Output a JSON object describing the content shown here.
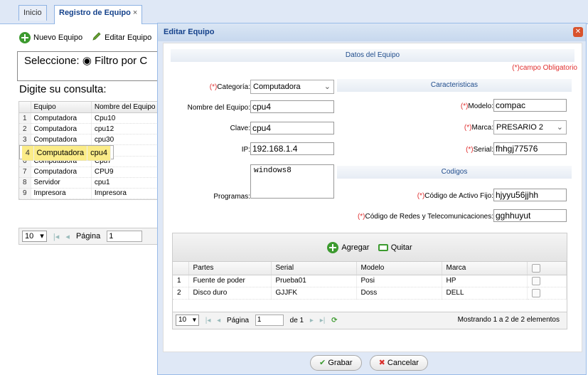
{
  "tabs": [
    {
      "label": "Inicio"
    },
    {
      "label": "Registro de Equipo",
      "close": "×"
    }
  ],
  "toolbar": {
    "nuevo": "Nuevo Equipo",
    "editar": "Editar Equipo"
  },
  "filter": {
    "legend": "Seleccione:",
    "radio_label": "Filtro por C"
  },
  "consulta_label": "Digite su consulta:",
  "grid": {
    "headers": [
      "Equipo",
      "Nombre del Equipo"
    ],
    "rows": [
      {
        "n": "1",
        "equipo": "Computadora",
        "nombre": "Cpu10"
      },
      {
        "n": "2",
        "equipo": "Computadora",
        "nombre": "cpu12"
      },
      {
        "n": "3",
        "equipo": "Computadora",
        "nombre": "cpu30"
      },
      {
        "n": "4",
        "equipo": "Computadora",
        "nombre": "cpu4"
      },
      {
        "n": "5",
        "equipo": "Computadora",
        "nombre": "cpu5"
      },
      {
        "n": "6",
        "equipo": "Computadora",
        "nombre": "Cpu7"
      },
      {
        "n": "7",
        "equipo": "Computadora",
        "nombre": "CPU9"
      },
      {
        "n": "8",
        "equipo": "Servidor",
        "nombre": "cpu1"
      },
      {
        "n": "9",
        "equipo": "Impresora",
        "nombre": "Impresora"
      }
    ],
    "pager": {
      "size": "10",
      "page_label": "Página",
      "page": "1"
    }
  },
  "modal": {
    "title": "Editar Equipo",
    "section_main": "Datos del Equipo",
    "obligatorio": "(*)campo Obligatorio",
    "caracteristicas": "Caracteristicas",
    "codigos": "Codigos",
    "fields": {
      "categoria_label": "Categoría:",
      "categoria": "Computadora",
      "nombre_label": "Nombre del Equipo:",
      "nombre": "cpu4",
      "clave_label": "Clave:",
      "clave": "cpu4",
      "ip_label": "IP:",
      "ip": "192.168.1.4",
      "programas_label": "Programas:",
      "programas": "windows8",
      "modelo_label": "Modelo:",
      "modelo": "compac",
      "marca_label": "Marca:",
      "marca": "PRESARIO 2",
      "serial_label": "Serial:",
      "serial": "fhhgj77576",
      "activo_label": "Código de Activo Fijo:",
      "activo": "hjyyu56jjhh",
      "redes_label": "Código de Redes y Telecomunicaciones:",
      "redes": "gghhuyut"
    },
    "req_mark": "(*)",
    "parts": {
      "agregar": "Agregar",
      "quitar": "Quitar",
      "headers": [
        "Partes",
        "Serial",
        "Modelo",
        "Marca"
      ],
      "rows": [
        {
          "n": "1",
          "partes": "Fuente de poder",
          "serial": "Prueba01",
          "modelo": "Posi",
          "marca": "HP"
        },
        {
          "n": "2",
          "partes": "Disco duro",
          "serial": "GJJFK",
          "modelo": "Doss",
          "marca": "DELL"
        }
      ],
      "pager": {
        "size": "10",
        "page_label": "Página",
        "page": "1",
        "of": "de 1",
        "status": "Mostrando 1 a 2 de 2 elementos"
      }
    },
    "grabar": "Grabar",
    "cancelar": "Cancelar"
  },
  "colors": {
    "accent": "#15428b",
    "required": "#e03030",
    "selected_row": "#fbec88"
  }
}
